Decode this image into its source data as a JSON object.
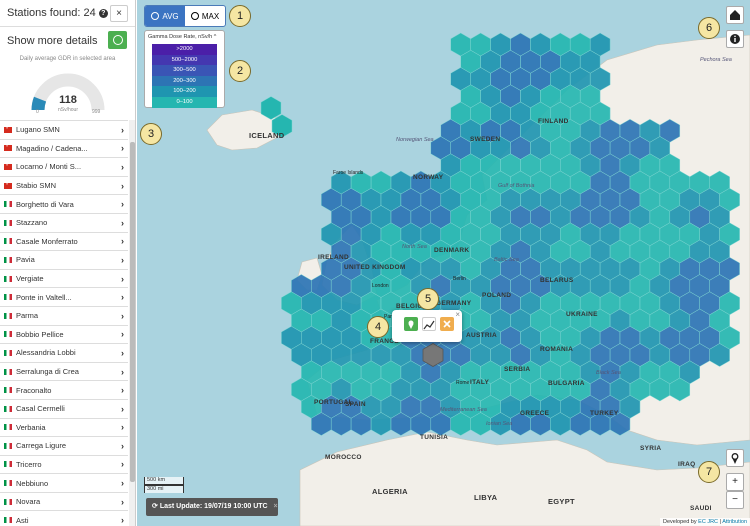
{
  "sidebar": {
    "stations_found_label": "Stations found:",
    "stations_found_count": "24",
    "close_label": "×",
    "show_details_label": "Show more details",
    "gdr_caption": "Daily average GDR in selected area",
    "gauge": {
      "value": "118",
      "unit": "nSv/hour",
      "min": "0",
      "max": "999",
      "fraction": 0.118,
      "fill_color": "#2a8ab8"
    },
    "stations": [
      {
        "name": "Lugano SMN",
        "country": "ch"
      },
      {
        "name": "Magadino / Cadena...",
        "country": "ch"
      },
      {
        "name": "Locarno / Monti S...",
        "country": "ch"
      },
      {
        "name": "Stabio SMN",
        "country": "ch"
      },
      {
        "name": "Borghetto di Vara",
        "country": "it"
      },
      {
        "name": "Stazzano",
        "country": "it"
      },
      {
        "name": "Casale Monferrato",
        "country": "it"
      },
      {
        "name": "Pavia",
        "country": "it"
      },
      {
        "name": "Vergiate",
        "country": "it"
      },
      {
        "name": "Ponte in Valtell...",
        "country": "it"
      },
      {
        "name": "Parma",
        "country": "it"
      },
      {
        "name": "Bobbio Pellice",
        "country": "it"
      },
      {
        "name": "Alessandria Lobbi",
        "country": "it"
      },
      {
        "name": "Serralunga di Crea",
        "country": "it"
      },
      {
        "name": "Fraconalto",
        "country": "it"
      },
      {
        "name": "Casal Cermelli",
        "country": "it"
      },
      {
        "name": "Verbania",
        "country": "it"
      },
      {
        "name": "Carrega Ligure",
        "country": "it"
      },
      {
        "name": "Tricerro",
        "country": "it"
      },
      {
        "name": "Nebbiuno",
        "country": "it"
      },
      {
        "name": "Novara",
        "country": "it"
      },
      {
        "name": "Asti",
        "country": "it"
      }
    ]
  },
  "toggle": {
    "avg_label": "AVG",
    "max_label": "MAX",
    "selected": "AVG"
  },
  "legend": {
    "title": "Gamma Dose Rate, nSv/h",
    "rows": [
      {
        "label": ">2000",
        "color": "#4b1fa8"
      },
      {
        "label": "500–2000",
        "color": "#4437b0"
      },
      {
        "label": "300–500",
        "color": "#3a55b5"
      },
      {
        "label": "200–300",
        "color": "#2d74b4"
      },
      {
        "label": "100–200",
        "color": "#1f95b0"
      },
      {
        "label": "0–100",
        "color": "#25b6b0"
      }
    ]
  },
  "callouts": [
    "1",
    "2",
    "3",
    "4",
    "5",
    "6",
    "7"
  ],
  "map_labels": {
    "countries": [
      "ICELAND",
      "NORWAY",
      "SWEDEN",
      "FINLAND",
      "UNITED KINGDOM",
      "POLAND",
      "UKRAINE",
      "FRANCE",
      "SPAIN",
      "ITALY",
      "GERMANY",
      "ROMANIA",
      "BELARUS",
      "TURKEY",
      "GREECE",
      "TUNISIA",
      "MOROCCO",
      "ALGERIA",
      "LIBYA",
      "EGYPT",
      "IRAQ",
      "SYRIA",
      "SAUDI",
      "IRELAND",
      "DENMARK",
      "BELGIUM",
      "PORTUGAL",
      "AUSTRIA",
      "SERBIA",
      "BULGARIA"
    ],
    "seas": [
      "Norwegian Sea",
      "North Sea",
      "Baltic Sea",
      "Pechora Sea",
      "Mediterranean Sea",
      "Ionian Sea",
      "Black Sea",
      "Gulf of Bothnia"
    ],
    "cities": [
      "Faroe Islands",
      "London",
      "Paris",
      "Berlin",
      "Rome"
    ]
  },
  "last_update": "Last Update: 19/07/19 10:00 UTC",
  "scale": {
    "km": "500 km",
    "mi": "300 mi"
  },
  "attribution": {
    "prefix": "Developed by",
    "link1": "EC JRC",
    "sep": "|",
    "link2": "Attribution"
  },
  "colors": {
    "sea": "#aad3df",
    "land": "#f2efe9",
    "hex_low": "#25b6b0",
    "hex_mid": "#1f95b0",
    "hex_high": "#2d74b4",
    "callout_fill": "#f5e6a3"
  }
}
